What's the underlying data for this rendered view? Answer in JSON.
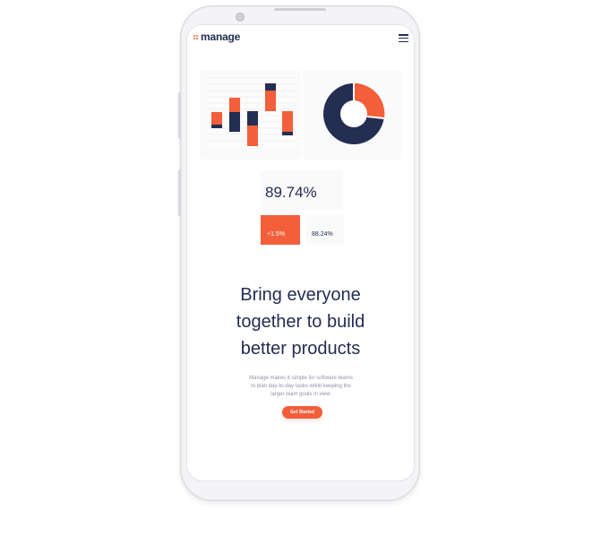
{
  "app": {
    "logo_text": "manage"
  },
  "hero": {
    "headline_line1": "Bring everyone",
    "headline_line2": "together to build",
    "headline_line3": "better products",
    "subtext_line1": "Manage makes it simple for software teams",
    "subtext_line2": "to plan day-to-day tasks while keeping the",
    "subtext_line3": "larger team goals in view.",
    "cta_label": "Get Started"
  },
  "stats": {
    "main_value": "89.74%",
    "change_value": "+1.5%",
    "secondary_value": "88.24%"
  },
  "colors": {
    "accent": "#f25f3a",
    "navy": "#242d52",
    "muted": "#9095a7"
  },
  "icons": {
    "menu": "hamburger-icon"
  }
}
